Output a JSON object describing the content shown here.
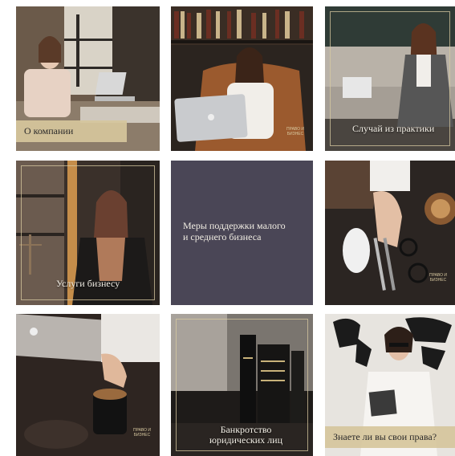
{
  "grid": {
    "tiles": [
      {
        "caption": "О компании"
      },
      {
        "caption": ""
      },
      {
        "caption": "Случай из практики"
      },
      {
        "caption": "Услуги бизнесу"
      },
      {
        "caption": "Меры поддержки малого\nи среднего бизнеса"
      },
      {
        "caption": ""
      },
      {
        "caption": ""
      },
      {
        "caption": "Банкротство\nюридических лиц"
      },
      {
        "caption": "Знаете ли вы свои права?"
      }
    ]
  },
  "brand": {
    "logo_text": "ПРАВО И БИЗНЕС",
    "accent": "#d6c69c",
    "panel_color": "#4a4656"
  }
}
